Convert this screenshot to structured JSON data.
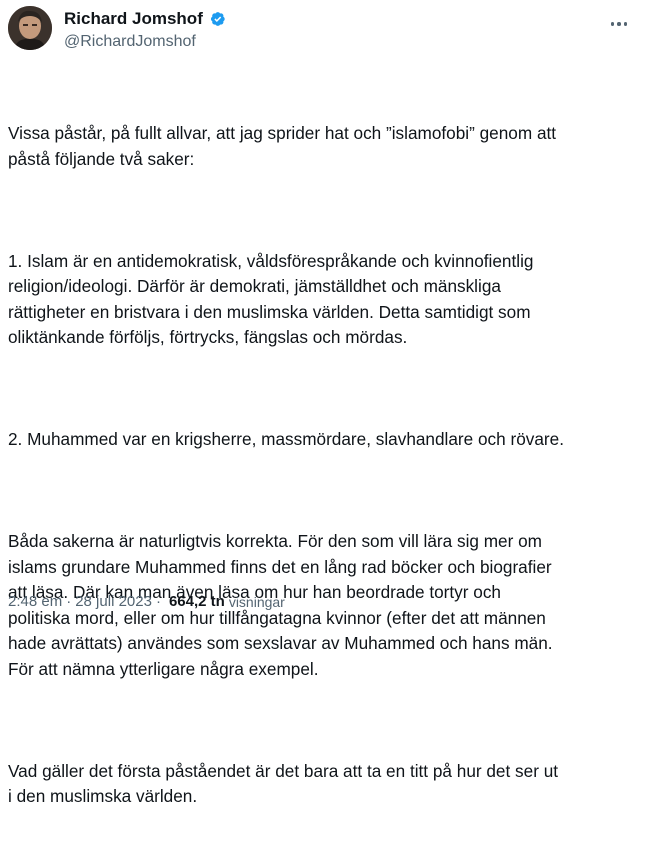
{
  "author": {
    "display_name": "Richard Jomshof",
    "handle": "@RichardJomshof",
    "verified_color": "#1d9bf0"
  },
  "tweet": {
    "paragraphs": [
      "Vissa påstår, på fullt allvar, att jag sprider hat och ”islamofobi” genom att\npåstå följande två saker:",
      "1. Islam är en antidemokratisk, våldsförespråkande och kvinnofientlig\nreligion/ideologi. Därför är demokrati, jämställdhet och mänskliga\nrättigheter en bristvara i den muslimska världen. Detta samtidigt som\noliktänkande förföljs, förtrycks, fängslas och mördas.",
      "2. Muhammed var en krigsherre, massmördare, slavhandlare och rövare.",
      "Båda sakerna är naturligtvis korrekta. För den som vill lära sig mer om\nislams grundare Muhammed finns det en lång rad böcker och biografier\natt läsa. Där kan man även läsa om hur han beordrade tortyr och\npolitiska mord, eller om hur tillfångatagna kvinnor (efter det att männen\nhade avrättats) användes som sexslavar av Muhammed och hans män.\nFör att nämna ytterligare några exempel.",
      "Vad gäller det första påståendet är det bara att ta en titt på hur det ser ut\ni den muslimska världen."
    ]
  },
  "meta": {
    "time": "2:48 em",
    "separator": "·",
    "date": "28 juli 2023",
    "views_count": "664,2 tn",
    "views_label": "visningar"
  },
  "icons": {
    "avatar": "avatar-photo",
    "verified": "verified-badge-icon",
    "more": "more-options-icon"
  }
}
